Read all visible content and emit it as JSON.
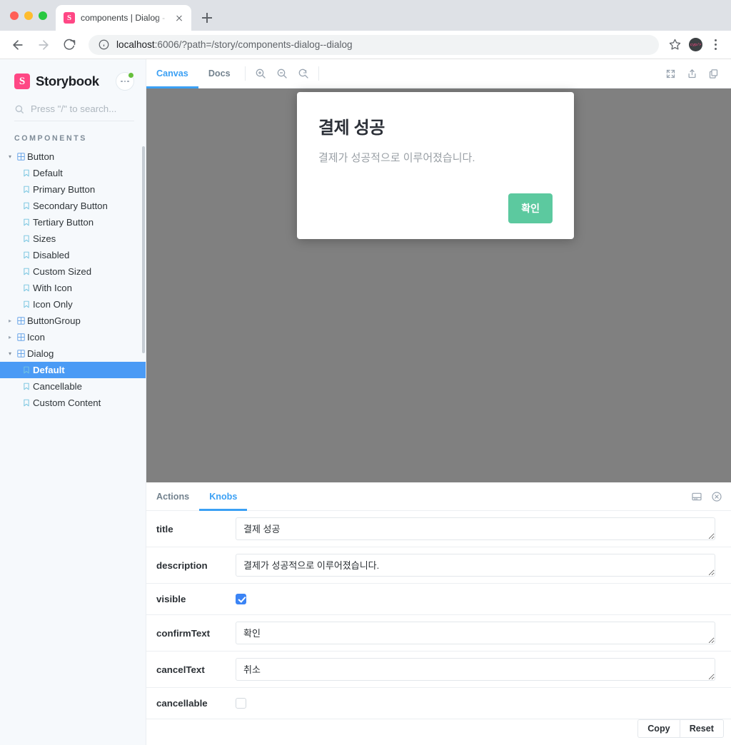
{
  "browser": {
    "tab": {
      "favicon_letter": "S",
      "favicon_name": "storybook-favicon",
      "title": "components | Dialog - Dialog"
    },
    "new_tab_label": "+",
    "address": {
      "host": "localhost",
      "rest": ":6006/?path=/story/components-dialog--dialog",
      "full": "localhost:6006/?path=/story/components-dialog--dialog"
    },
    "profile_initials": "cyp/>"
  },
  "sidebar": {
    "brand": "Storybook",
    "logo_letter": "S",
    "search_placeholder": "Press \"/\" to search...",
    "section_label": "COMPONENTS",
    "tree": [
      {
        "label": "Button",
        "type": "component",
        "expanded": true,
        "selected": false
      },
      {
        "label": "Default",
        "type": "story",
        "selected": false
      },
      {
        "label": "Primary Button",
        "type": "story",
        "selected": false
      },
      {
        "label": "Secondary Button",
        "type": "story",
        "selected": false
      },
      {
        "label": "Tertiary Button",
        "type": "story",
        "selected": false
      },
      {
        "label": "Sizes",
        "type": "story",
        "selected": false
      },
      {
        "label": "Disabled",
        "type": "story",
        "selected": false
      },
      {
        "label": "Custom Sized",
        "type": "story",
        "selected": false
      },
      {
        "label": "With Icon",
        "type": "story",
        "selected": false
      },
      {
        "label": "Icon Only",
        "type": "story",
        "selected": false
      },
      {
        "label": "ButtonGroup",
        "type": "component",
        "expanded": false,
        "selected": false
      },
      {
        "label": "Icon",
        "type": "component",
        "expanded": false,
        "selected": false
      },
      {
        "label": "Dialog",
        "type": "component",
        "expanded": true,
        "selected": false
      },
      {
        "label": "Default",
        "type": "story",
        "selected": true
      },
      {
        "label": "Cancellable",
        "type": "story",
        "selected": false
      },
      {
        "label": "Custom Content",
        "type": "story",
        "selected": false
      }
    ]
  },
  "canvas_toolbar": {
    "tabs": [
      {
        "label": "Canvas",
        "active": true
      },
      {
        "label": "Docs",
        "active": false
      }
    ],
    "zoom_in_name": "zoom-in-icon",
    "zoom_out_name": "zoom-out-icon",
    "zoom_reset_name": "zoom-reset-icon",
    "fullscreen_name": "fullscreen-icon",
    "open_new_tab_name": "share-icon",
    "copy_link_name": "copy-icon"
  },
  "preview": {
    "background_color": "#808080",
    "dialog": {
      "title": "결제 성공",
      "description": "결제가 성공적으로 이루어졌습니다.",
      "confirm_label": "확인",
      "confirm_color": "#5cc99f"
    }
  },
  "addons": {
    "tabs": [
      {
        "label": "Actions",
        "active": false
      },
      {
        "label": "Knobs",
        "active": true
      }
    ],
    "layout_icon_name": "panel-position-icon",
    "close_icon_name": "close-circle-icon",
    "knobs": [
      {
        "name": "title",
        "type": "text",
        "value": "결제 성공"
      },
      {
        "name": "description",
        "type": "text",
        "value": "결제가 성공적으로 이루어졌습니다."
      },
      {
        "name": "visible",
        "type": "checkbox",
        "checked": true
      },
      {
        "name": "confirmText",
        "type": "text",
        "value": "확인"
      },
      {
        "name": "cancelText",
        "type": "text",
        "value": "취소"
      },
      {
        "name": "cancellable",
        "type": "checkbox",
        "checked": false
      }
    ],
    "footer": {
      "copy_label": "Copy",
      "reset_label": "Reset"
    }
  },
  "colors": {
    "accent_blue": "#3ba0f4",
    "selection_blue": "#4b9bf5",
    "brand_pink": "#ff4785",
    "sidebar_bg": "#f6f9fc"
  }
}
